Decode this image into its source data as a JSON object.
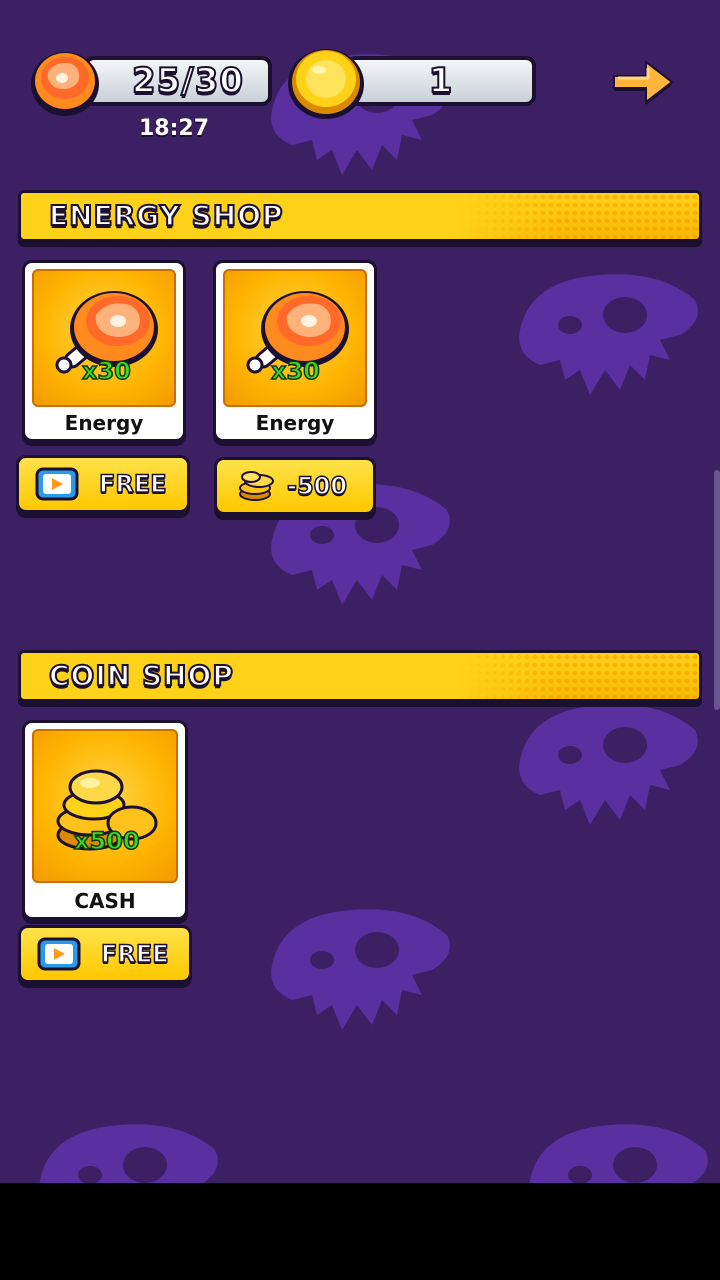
{
  "header": {
    "energy": "25/30",
    "timer": "18:27",
    "coins": "1"
  },
  "energy_shop": {
    "title": "ENERGY SHOP",
    "items": [
      {
        "label": "Energy",
        "quantity": "x30",
        "button": "FREE",
        "button_icon": "video-ad-icon"
      },
      {
        "label": "Energy",
        "quantity": "x30",
        "button": "-500",
        "button_icon": "coin-stack-icon"
      }
    ]
  },
  "coin_shop": {
    "title": "COIN SHOP",
    "items": [
      {
        "label": "CASH",
        "quantity": "x500",
        "button": "FREE",
        "button_icon": "video-ad-icon"
      }
    ]
  },
  "colors": {
    "background": "#3d1f63",
    "skull": "#5a2fa0",
    "accent": "#ffc800",
    "outline": "#1b1030"
  }
}
